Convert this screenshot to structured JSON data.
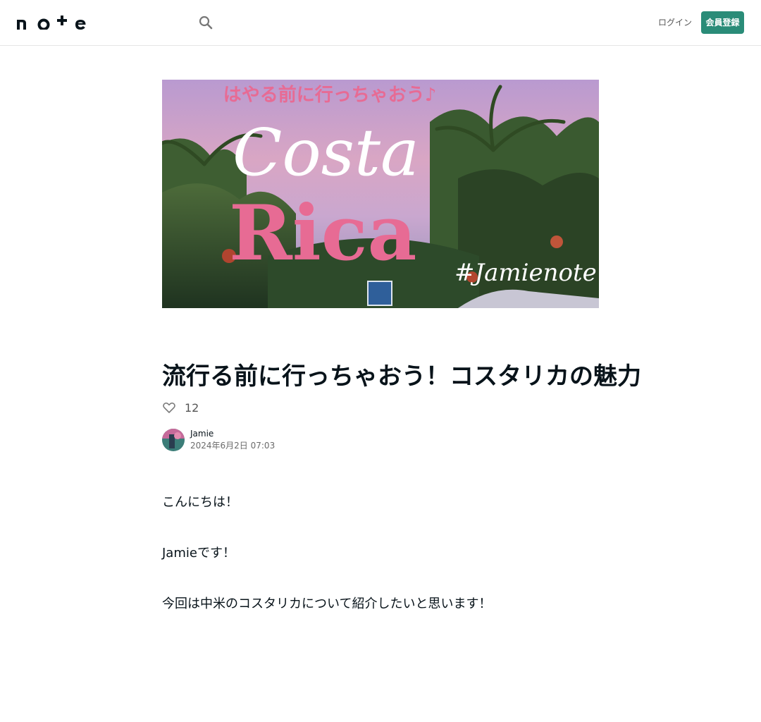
{
  "header": {
    "logo_text": "note",
    "search_icon": "search-icon",
    "login_label": "ログイン",
    "signup_label": "会員登録",
    "accent_color": "#2a8c78"
  },
  "hero": {
    "overlay_caption": "はやる前に行っちゃおう♪",
    "script_title_line1": "Costa",
    "script_title_line2": "Rica",
    "hashtag": "#Jamienote"
  },
  "article": {
    "title": "流行る前に行っちゃおう！コスタリカの魅力",
    "likes": "12",
    "author_name": "Jamie",
    "post_date": "2024年6月2日 07:03",
    "paragraphs": [
      "こんにちは！",
      "Jamieです！",
      "今回は中米のコスタリカについて紹介したいと思います！"
    ]
  }
}
